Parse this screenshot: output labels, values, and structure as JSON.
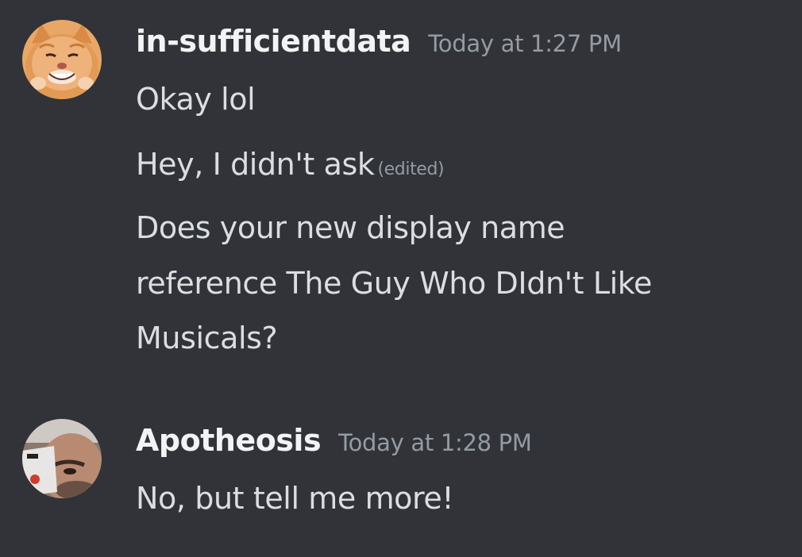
{
  "messages": [
    {
      "author": "in-sufficientdata",
      "timestamp": "Today at 1:27 PM",
      "avatar_icon": "orange-cat-avatar",
      "lines": [
        {
          "text": "Okay lol",
          "edited": ""
        },
        {
          "text": "Hey, I didn't ask",
          "edited": "(edited)"
        },
        {
          "text": "Does your new display name",
          "edited": ""
        },
        {
          "text": "reference The Guy Who DIdn't Like",
          "edited": ""
        },
        {
          "text": "Musicals?",
          "edited": ""
        }
      ]
    },
    {
      "author": "Apotheosis",
      "timestamp": "Today at 1:28 PM",
      "avatar_icon": "man-drinking-avatar",
      "lines": [
        {
          "text": "No, but tell me more!",
          "edited": ""
        }
      ]
    }
  ],
  "colors": {
    "background": "#313338",
    "username": "#f2f3f5",
    "message_text": "#dbdee1",
    "muted": "#949ba4"
  }
}
